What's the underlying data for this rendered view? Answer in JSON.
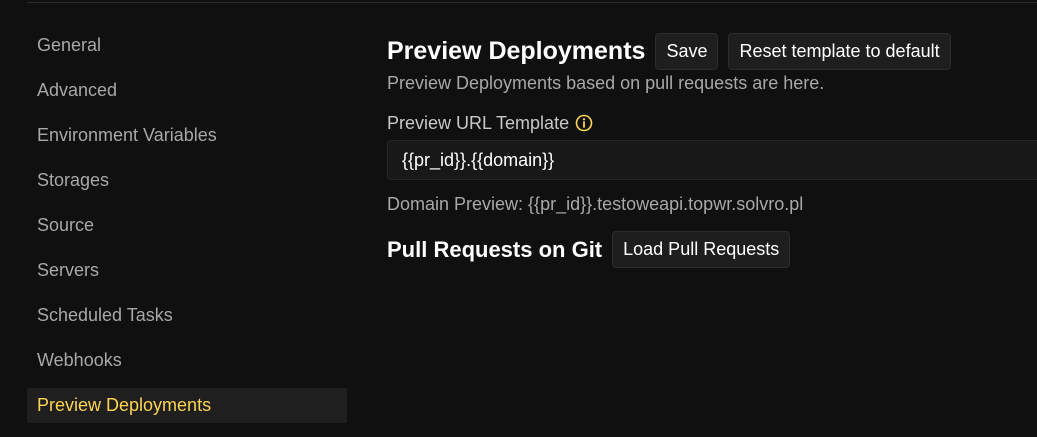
{
  "sidebar": {
    "items": [
      {
        "label": "General"
      },
      {
        "label": "Advanced"
      },
      {
        "label": "Environment Variables"
      },
      {
        "label": "Storages"
      },
      {
        "label": "Source"
      },
      {
        "label": "Servers"
      },
      {
        "label": "Scheduled Tasks"
      },
      {
        "label": "Webhooks"
      },
      {
        "label": "Preview Deployments",
        "active": true
      }
    ]
  },
  "main": {
    "title": "Preview Deployments",
    "save_label": "Save",
    "reset_label": "Reset template to default",
    "subtitle": "Preview Deployments based on pull requests are here.",
    "url_template_label": "Preview URL Template",
    "url_template_value": "{{pr_id}}.{{domain}}",
    "domain_preview": "Domain Preview: {{pr_id}}.testoweapi.topwr.solvro.pl",
    "pull_requests_title": "Pull Requests on Git",
    "load_pr_label": "Load Pull Requests"
  },
  "colors": {
    "background": "#101010",
    "accent": "#fcd452",
    "muted_text": "#a8a8a8",
    "button_bg": "#1e1e1e"
  },
  "icons": {
    "info": "info-icon"
  }
}
